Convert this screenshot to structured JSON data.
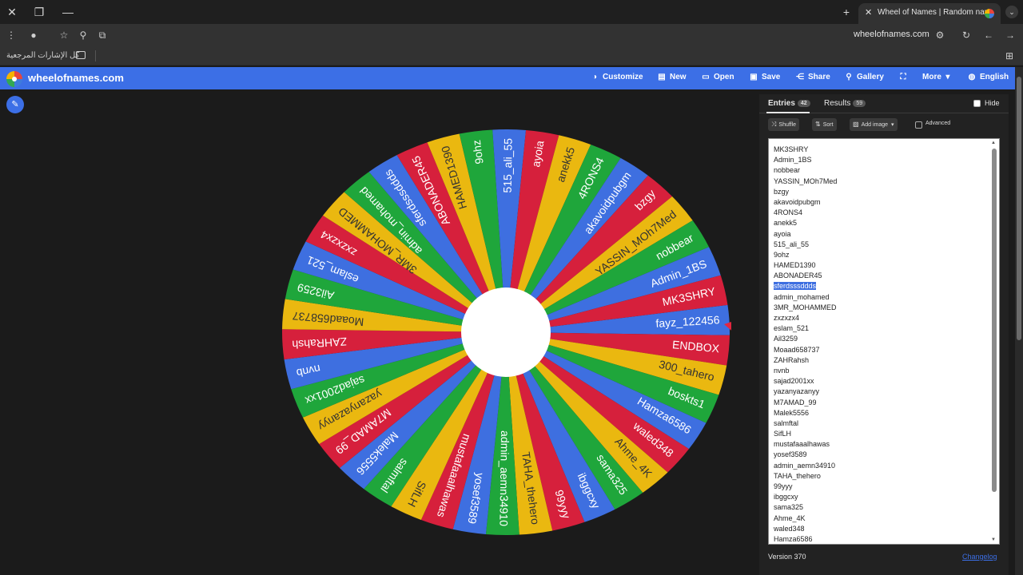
{
  "browser": {
    "tab_title": "Wheel of Names | Random nam",
    "url": "wheelofnames.com",
    "bookmarks_label": "كل الإشارات المرجعية"
  },
  "app": {
    "site_name": "wheelofnames.com",
    "menu": {
      "customize": "Customize",
      "new": "New",
      "open": "Open",
      "save": "Save",
      "share": "Share",
      "gallery": "Gallery",
      "more": "More",
      "language": "English"
    }
  },
  "panel": {
    "entries_tab": "Entries",
    "entries_count": "42",
    "results_tab": "Results",
    "results_count": "59",
    "hide_label": "Hide",
    "shuffle_label": "Shuffle",
    "sort_label": "Sort",
    "add_image_label": "Add image",
    "advanced_label": "Advanced",
    "version": "Version 370",
    "changelog": "Changelog",
    "entries": [
      "MK3SHRY",
      "Admin_1BS",
      "nobbear",
      "YASSIN_MOh7Med",
      "bzgy",
      "akavoidpubgm",
      "4RONS4",
      "anekk5",
      "ayoia",
      "515_ali_55",
      "9ohz",
      "HAMED1390",
      "ABONADER45",
      "sferdsssddds",
      "admin_mohamed",
      "3MR_MOHAMMED",
      "zxzxzx4",
      "eslam_521",
      "Ail3259",
      "Moaad658737",
      "ZAHRahsh",
      "nvnb",
      "sajad2001xx",
      "yazanyazanyy",
      "M7AMAD_99",
      "Malek5556",
      "salmftal",
      "SifLH",
      "mustafaaalhawas",
      "yosef3589",
      "admin_aemn34910",
      "TAHA_thehero",
      "99yyy",
      "ibggcxy",
      "sama325",
      "Ahme_4K",
      "waled348",
      "Hamza6586"
    ],
    "selected_entry_index": 13
  },
  "wheel": {
    "segment_colors": [
      "#3e6fe0",
      "#d6203c",
      "#eab810",
      "#1fa63b"
    ],
    "pointer_color": "#e4263f",
    "labels": [
      "fayz_122456",
      "ENDBOX",
      "300_tahero",
      "boskts1",
      "Hamza6586",
      "waled348",
      "Ahme_4K",
      "sama325",
      "ibggcxy",
      "99yyy",
      "TAHA_thehero",
      "admin_aemn34910",
      "yosef3589",
      "mustafaaalhawas",
      "SifLH",
      "salmftal",
      "Malek5556",
      "M7AMAD_99",
      "yazanyazanyy",
      "sajad2001xx",
      "nvnb",
      "ZAHRahsh",
      "Moaad658737",
      "Ail3259",
      "eslam_521",
      "zxzxzx4",
      "3MR_MOHAMMED",
      "admin_mohamed",
      "sferdsssddds",
      "ABONADER45",
      "HAMED1390",
      "9ohz",
      "515_ali_55",
      "ayoia",
      "anekk5",
      "4RONS4",
      "akavoidpubgm",
      "bzgy",
      "YASSIN_MOh7Med",
      "nobbear",
      "Admin_1BS",
      "MK3SHRY"
    ]
  }
}
